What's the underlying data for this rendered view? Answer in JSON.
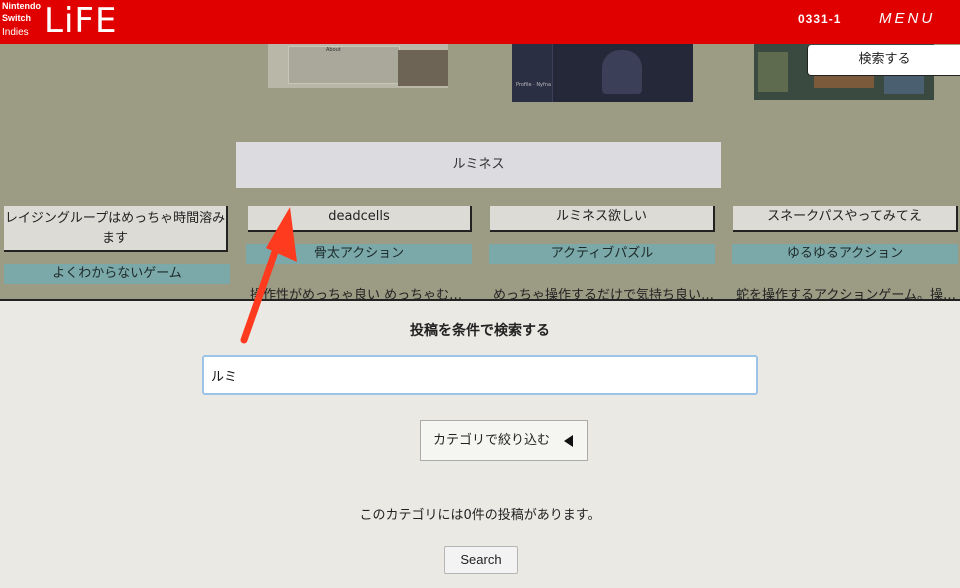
{
  "header": {
    "logo_line1": "Nintendo",
    "logo_line2": "Switch",
    "logo_line3": "Indies",
    "logo_main": "LiFE",
    "code": "0331-1",
    "menu_label": "MENU",
    "background_color": "#e00000"
  },
  "search_top_button": "検索する",
  "suggestion": "ルミネス",
  "posts": [
    {
      "title": "レイジングループはめっちゃ時間溶みます",
      "tag": "よくわからないゲーム",
      "description": ""
    },
    {
      "title": "deadcells",
      "tag": "骨太アクション",
      "description": "操作性がめっちゃ良い めっちゃむ…"
    },
    {
      "title": "ルミネス欲しい",
      "tag": "アクティブパズル",
      "description": "めっちゃ操作するだけで気持ち良い…"
    },
    {
      "title": "スネークパスやってみてえ",
      "tag": "ゆるゆるアクション",
      "description": "蛇を操作するアクションゲーム。操…"
    }
  ],
  "panel": {
    "title": "投稿を条件で検索する",
    "search_value": "ルミ",
    "category_button": "カテゴリで絞り込む",
    "result_text": "このカテゴリには0件の投稿があります。",
    "submit_label": "Search"
  },
  "thumbnails": {
    "thumb1_caption": "About",
    "thumb2_caption": "Profile · Nyfna"
  },
  "colors": {
    "accent_red": "#e00000",
    "tag_teal": "#7ba8a8",
    "input_focus": "#9dc4e6",
    "arrow": "#ff3b1f"
  }
}
